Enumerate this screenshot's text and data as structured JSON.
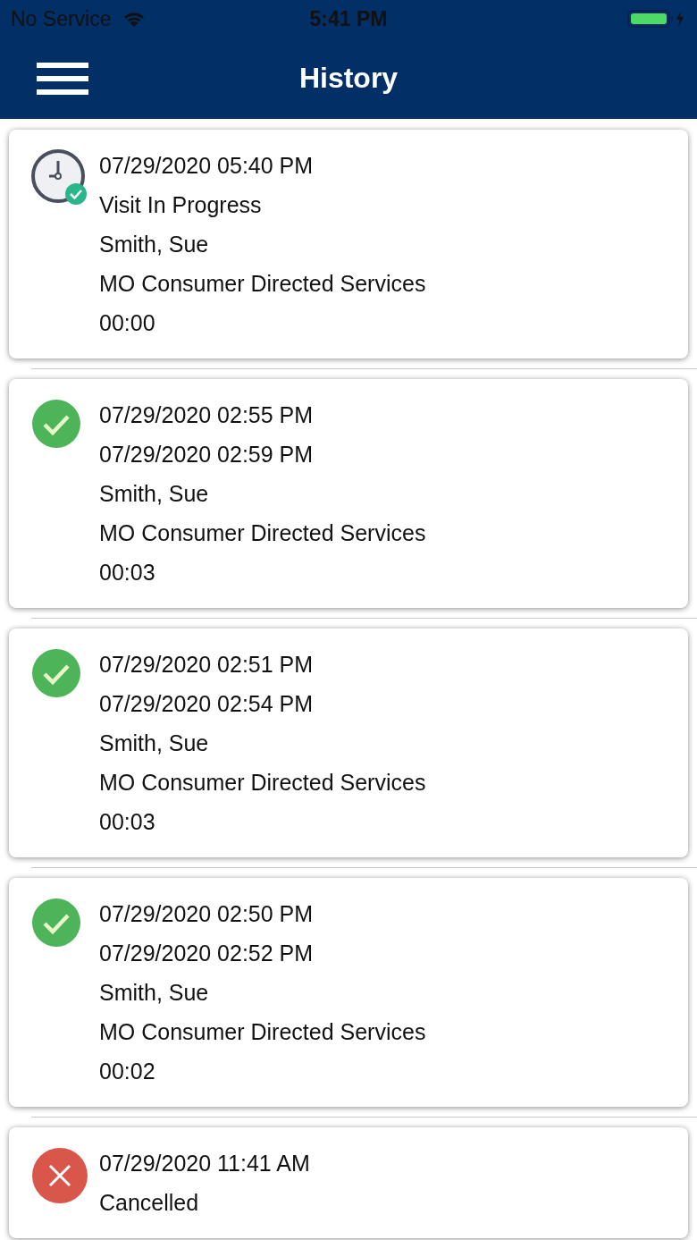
{
  "status_bar": {
    "carrier": "No Service",
    "time": "5:41 PM"
  },
  "nav_bar": {
    "title": "History"
  },
  "visits": [
    {
      "kind": "in_progress",
      "lines": [
        "07/29/2020 05:40 PM",
        "Visit In Progress",
        "Smith, Sue",
        "MO Consumer Directed Services",
        "00:00"
      ]
    },
    {
      "kind": "completed",
      "lines": [
        "07/29/2020 02:55 PM",
        "07/29/2020 02:59 PM",
        "Smith, Sue",
        "MO Consumer Directed Services",
        "00:03"
      ]
    },
    {
      "kind": "completed",
      "lines": [
        "07/29/2020 02:51 PM",
        "07/29/2020 02:54 PM",
        "Smith, Sue",
        "MO Consumer Directed Services",
        "00:03"
      ]
    },
    {
      "kind": "completed",
      "lines": [
        "07/29/2020 02:50 PM",
        "07/29/2020 02:52 PM",
        "Smith, Sue",
        "MO Consumer Directed Services",
        "00:02"
      ]
    },
    {
      "kind": "cancelled",
      "lines": [
        "07/29/2020 11:41 AM",
        "Cancelled"
      ]
    }
  ]
}
